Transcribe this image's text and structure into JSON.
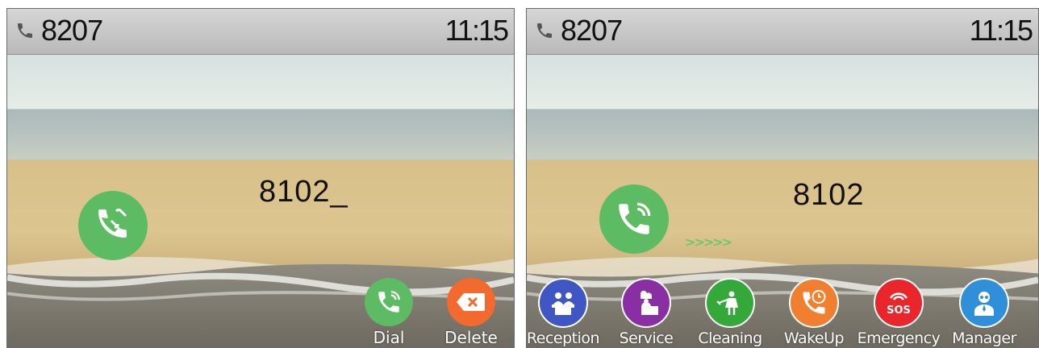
{
  "left_screen": {
    "status": {
      "extension": "8207",
      "time": "11:15"
    },
    "dial_input": "8102_",
    "softkeys": [
      {
        "label": "Dial",
        "icon": "phone-icon",
        "color": "#5dbb64"
      },
      {
        "label": "Delete",
        "icon": "backspace-icon",
        "color": "#f26a2e"
      }
    ]
  },
  "right_screen": {
    "status": {
      "extension": "8207",
      "time": "11:15"
    },
    "dialed_number": "8102",
    "progress_chevrons": ">>>>>",
    "service_keys": [
      {
        "label": "Reception",
        "icon": "reception-icon",
        "color": "#3f56c4"
      },
      {
        "label": "Service",
        "icon": "chef-icon",
        "color": "#8a2fa3"
      },
      {
        "label": "Cleaning",
        "icon": "cleaning-icon",
        "color": "#35a83a"
      },
      {
        "label": "WakeUp",
        "icon": "wakeup-icon",
        "color": "#f08030"
      },
      {
        "label": "Emergency",
        "icon": "sos-icon",
        "color": "#e8262b"
      },
      {
        "label": "Manager",
        "icon": "manager-icon",
        "color": "#2f8fd8"
      }
    ]
  },
  "colors": {
    "call_green": "#5dbb64"
  }
}
